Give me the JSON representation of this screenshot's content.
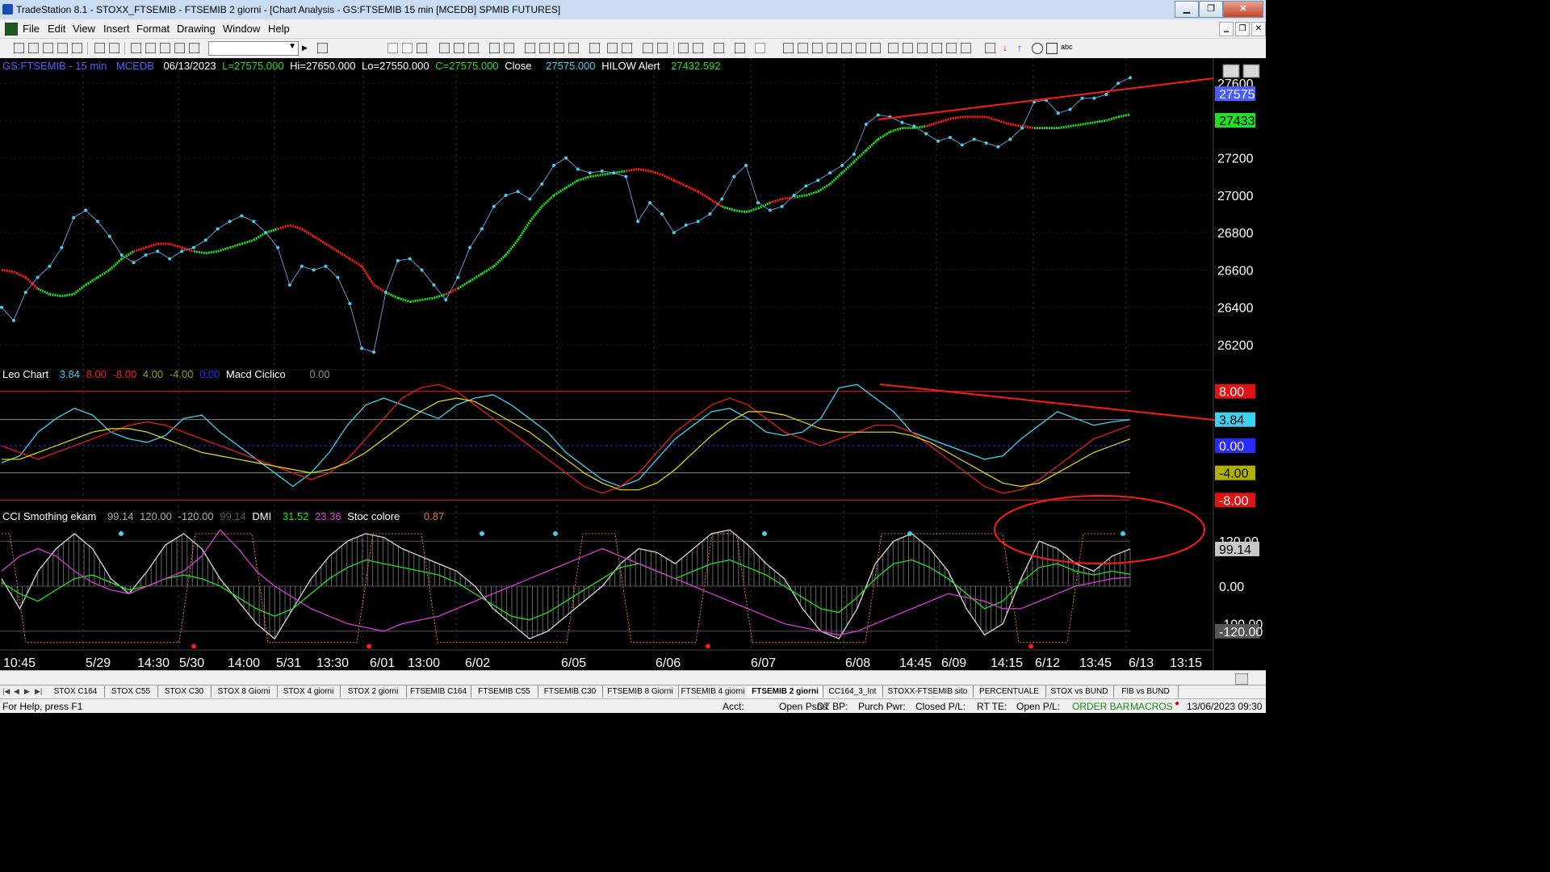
{
  "window": {
    "title": "TradeStation 8.1 - STOXX_FTSEMIB - FTSEMIB  2 giorni - [Chart Analysis - GS:FTSEMIB  15 min  [MCEDB] SPMIB FUTURES]",
    "minimize_label": "▁",
    "restore_label": "❐",
    "close_label": "✕"
  },
  "menu": {
    "items": [
      "File",
      "Edit",
      "View",
      "Insert",
      "Format",
      "Drawing",
      "Window",
      "Help"
    ],
    "mdi": [
      "‗",
      "❐",
      "✕"
    ]
  },
  "colors": {
    "price": "#3fd2ee",
    "red": "#ff1a1a",
    "green": "#21e021",
    "yellow": "#e6e600",
    "magenta": "#d63bd6",
    "orange": "#e07a1f",
    "white": "#d8d8d8",
    "grid": "#3a3a3a",
    "label": "#ffffff"
  },
  "price_header": {
    "symbol": "GS:FTSEMIB - 15 min",
    "source": "MCEDB",
    "date": "06/13/2023",
    "last": "L=27575.000",
    "high": "Hi=27650.000",
    "low": "Lo=27550.000",
    "close_c": "C=27575.000",
    "close_label": "Close",
    "close_value": "27575.000",
    "alert_label": "HILOW Alert",
    "alert_value": "27432.592"
  },
  "price_axis": {
    "ticks": [
      "27600",
      "27400",
      "27200",
      "27000",
      "26800",
      "26600",
      "26400",
      "26200"
    ],
    "badge_last": "27575",
    "badge_alert": "27433"
  },
  "chart_data": {
    "type": "line",
    "panels": [
      {
        "name": "price",
        "y_range": [
          26100,
          27700
        ],
        "series": [
          {
            "name": "Close",
            "color": "#3fd2ee",
            "values": [
              26400,
              26330,
              26480,
              26560,
              26620,
              26720,
              26880,
              26920,
              26860,
              26780,
              26680,
              26640,
              26680,
              26700,
              26660,
              26700,
              26720,
              26760,
              26820,
              26860,
              26890,
              26860,
              26800,
              26720,
              26520,
              26620,
              26600,
              26620,
              26560,
              26420,
              26180,
              26160,
              26480,
              26650,
              26660,
              26600,
              26520,
              26440,
              26560,
              26720,
              26820,
              26940,
              27000,
              27020,
              26980,
              27060,
              27160,
              27200,
              27140,
              27120,
              27130,
              27120,
              27100,
              26860,
              26960,
              26900,
              26800,
              26840,
              26860,
              26900,
              26980,
              27100,
              27160,
              26960,
              26920,
              26940,
              27000,
              27050,
              27080,
              27120,
              27160,
              27220,
              27380,
              27430,
              27420,
              27390,
              27370,
              27330,
              27290,
              27310,
              27270,
              27300,
              27280,
              27260,
              27300,
              27360,
              27500,
              27510,
              27440,
              27460,
              27520,
              27520,
              27540,
              27600,
              27630
            ]
          },
          {
            "name": "HILOW",
            "color_up": "#21e021",
            "color_down": "#ff1a1a",
            "values": [
              26600,
              26590,
              26560,
              26500,
              26470,
              26460,
              26470,
              26520,
              26560,
              26600,
              26660,
              26700,
              26720,
              26740,
              26740,
              26720,
              26700,
              26690,
              26700,
              26720,
              26740,
              26760,
              26800,
              26820,
              26840,
              26820,
              26780,
              26740,
              26700,
              26660,
              26620,
              26520,
              26480,
              26450,
              26430,
              26440,
              26450,
              26470,
              26500,
              26540,
              26580,
              26620,
              26680,
              26760,
              26860,
              26940,
              27000,
              27040,
              27080,
              27100,
              27110,
              27120,
              27130,
              27140,
              27130,
              27110,
              27080,
              27050,
              27020,
              26980,
              26940,
              26920,
              26910,
              26930,
              26960,
              26980,
              26990,
              27000,
              27020,
              27060,
              27120,
              27180,
              27240,
              27300,
              27340,
              27360,
              27360,
              27370,
              27390,
              27410,
              27420,
              27420,
              27420,
              27400,
              27380,
              27370,
              27360,
              27360,
              27360,
              27370,
              27380,
              27390,
              27400,
              27420,
              27433
            ]
          }
        ]
      },
      {
        "name": "Leo Chart / Macd Ciclico",
        "y_range": [
          -9.5,
          9.5
        ],
        "levels": [
          8.0,
          3.84,
          0.0,
          -4.0,
          -8.0
        ],
        "series": [
          {
            "name": "Leo Chart",
            "color": "#3fd2ee",
            "values": [
              -2.5,
              -1.5,
              2,
              4,
              5.5,
              4.5,
              2,
              1,
              0.5,
              1.5,
              4,
              4.5,
              2,
              0,
              -2,
              -4,
              -6,
              -4,
              -1,
              3,
              6,
              7,
              6,
              5,
              4,
              6,
              7,
              7.5,
              6,
              4,
              2,
              -1,
              -3,
              -5,
              -6,
              -5,
              -2,
              1,
              3,
              5,
              5.5,
              4,
              2,
              1.5,
              2,
              4,
              8.5,
              9,
              7,
              5,
              2,
              1,
              0,
              -1,
              -2,
              -1.5,
              1,
              3,
              5,
              4,
              3,
              3.5,
              3.84
            ]
          },
          {
            "name": "Macd Ciclico",
            "color": "#ff1a1a",
            "values": [
              0,
              -1,
              -2,
              -1,
              0,
              1,
              2,
              3,
              3.5,
              3,
              2,
              1,
              0,
              -1,
              -2,
              -3,
              -4,
              -5,
              -4,
              -2,
              1,
              4,
              7,
              8.5,
              9,
              8,
              6,
              4,
              2,
              0,
              -2,
              -4,
              -6,
              -7,
              -6,
              -4,
              -1,
              2,
              4,
              6,
              7,
              6,
              4,
              2,
              1,
              0,
              1,
              2,
              3,
              3,
              2,
              0,
              -2,
              -4,
              -6,
              -7,
              -6.5,
              -5,
              -3,
              -1,
              1,
              2,
              3
            ]
          },
          {
            "name": "Signal",
            "color": "#e6e600",
            "values": [
              -2,
              -2,
              -1,
              0,
              1,
              2,
              2.5,
              2.5,
              2,
              1,
              0,
              -1,
              -1.5,
              -2,
              -2.5,
              -3,
              -3.5,
              -4,
              -3.5,
              -2.5,
              -1,
              1,
              3,
              5,
              6.5,
              7,
              6.5,
              5,
              3.5,
              2,
              0,
              -2,
              -4,
              -5.5,
              -6.5,
              -6.5,
              -5.5,
              -3.5,
              -1,
              1.5,
              3.5,
              5,
              5,
              4.5,
              3.5,
              2.5,
              2,
              2,
              2,
              2,
              1.5,
              0.5,
              -1,
              -2.5,
              -4,
              -5.5,
              -6,
              -5.5,
              -4,
              -2.5,
              -1,
              0,
              1
            ]
          }
        ]
      },
      {
        "name": "CCI Smothing ekam / DMI / Stoc colore",
        "y_range": [
          -170,
          170
        ],
        "levels": [
          120.0,
          0.0,
          -120.0
        ],
        "series": [
          {
            "name": "CCI Smothing ekam",
            "color": "#d8d8d8",
            "values": [
              20,
              -60,
              40,
              100,
              140,
              100,
              20,
              -20,
              40,
              110,
              140,
              100,
              20,
              -40,
              -100,
              -140,
              -60,
              20,
              80,
              120,
              140,
              130,
              100,
              80,
              60,
              40,
              0,
              -60,
              -100,
              -140,
              -120,
              -80,
              -40,
              0,
              60,
              100,
              90,
              60,
              100,
              140,
              150,
              110,
              60,
              20,
              -60,
              -120,
              -140,
              -60,
              60,
              120,
              140,
              100,
              40,
              -60,
              -130,
              -100,
              20,
              120,
              100,
              60,
              40,
              80,
              99.14
            ]
          },
          {
            "name": "DMI +",
            "color": "#21e021",
            "values": [
              10,
              -20,
              -40,
              -10,
              20,
              30,
              10,
              -10,
              0,
              20,
              30,
              20,
              0,
              -30,
              -60,
              -80,
              -60,
              -20,
              20,
              50,
              70,
              60,
              50,
              40,
              30,
              10,
              -20,
              -50,
              -80,
              -90,
              -70,
              -40,
              -10,
              20,
              50,
              60,
              40,
              20,
              40,
              60,
              70,
              50,
              30,
              0,
              -30,
              -60,
              -70,
              -30,
              20,
              60,
              70,
              50,
              20,
              -20,
              -60,
              -40,
              10,
              50,
              60,
              40,
              30,
              40,
              31.52
            ]
          },
          {
            "name": "DMI -",
            "color": "#d63bd6",
            "values": [
              40,
              80,
              100,
              80,
              40,
              10,
              -10,
              -20,
              0,
              20,
              40,
              80,
              150,
              100,
              40,
              0,
              -30,
              -60,
              -80,
              -100,
              -110,
              -120,
              -100,
              -90,
              -80,
              -60,
              -40,
              -20,
              0,
              20,
              40,
              60,
              80,
              100,
              80,
              60,
              40,
              20,
              0,
              -20,
              -40,
              -60,
              -80,
              -100,
              -110,
              -120,
              -130,
              -120,
              -100,
              -80,
              -60,
              -40,
              -20,
              -30,
              -40,
              -60,
              -60,
              -40,
              -20,
              0,
              10,
              20,
              23.36
            ]
          }
        ]
      }
    ],
    "x_labels": [
      "10:45",
      "5/29",
      "14:30",
      "5/30",
      "14:00",
      "5/31",
      "13:30",
      "6/01",
      "13:00",
      "6/02",
      "6/05",
      "6/06",
      "6/07",
      "6/08",
      "14:45",
      "6/09",
      "14:15",
      "6/12",
      "13:45",
      "6/13",
      "13:15"
    ]
  },
  "osc1": {
    "name": "Leo Chart",
    "v1": "3.84",
    "v2": "8.00",
    "v3": "-8.00",
    "v4": "4.00",
    "v5": "-4.00",
    "v6": "0.00",
    "name2": "Macd Ciclico",
    "v7": "0.00",
    "badges": [
      "8.00",
      "3.84",
      "0.00",
      "-4.00",
      "-8.00"
    ]
  },
  "osc2": {
    "name": "CCI Smothing ekam",
    "v1": "99.14",
    "v2": "120.00",
    "v3": "-120.00",
    "v4": "99.14",
    "dmi": "DMI",
    "dmi1": "31.52",
    "dmi2": "23.36",
    "stoc": "Stoc colore",
    "stoc_v": "0.87",
    "axis": [
      "120.00",
      "99.14",
      "0.00",
      "-100.00",
      "-120.00"
    ]
  },
  "tabs": [
    "STOX C164",
    "STOX C55",
    "STOX  C30",
    "STOX  8 Giorni",
    "STOX 4 giorni",
    "STOX  2 giorni",
    "FTSEMIB C164",
    "FTSEMIB C55",
    "FTSEMIB C30",
    "FTSEMIB  8 Giorni",
    "FTSEMIB  4 giorni",
    "FTSEMIB  2 giorni",
    "CC164_3_Int",
    "STOXX-FTSEMIB sito",
    "PERCENTUALE",
    "STOX vs BUND",
    "FIB vs BUND"
  ],
  "status": {
    "help": "For Help, press F1",
    "acct": "Acct:",
    "open_psns": "Open Psns:",
    "dt_bp": "DT BP:",
    "purch_pwr": "Purch Pwr:",
    "closed_pl": "Closed P/L:",
    "rt_te": "RT TE:",
    "open_pl": "Open P/L:",
    "order_bar": "ORDER BAR",
    "macros": "MACROS",
    "datetime": "13/06/2023 09:30"
  }
}
